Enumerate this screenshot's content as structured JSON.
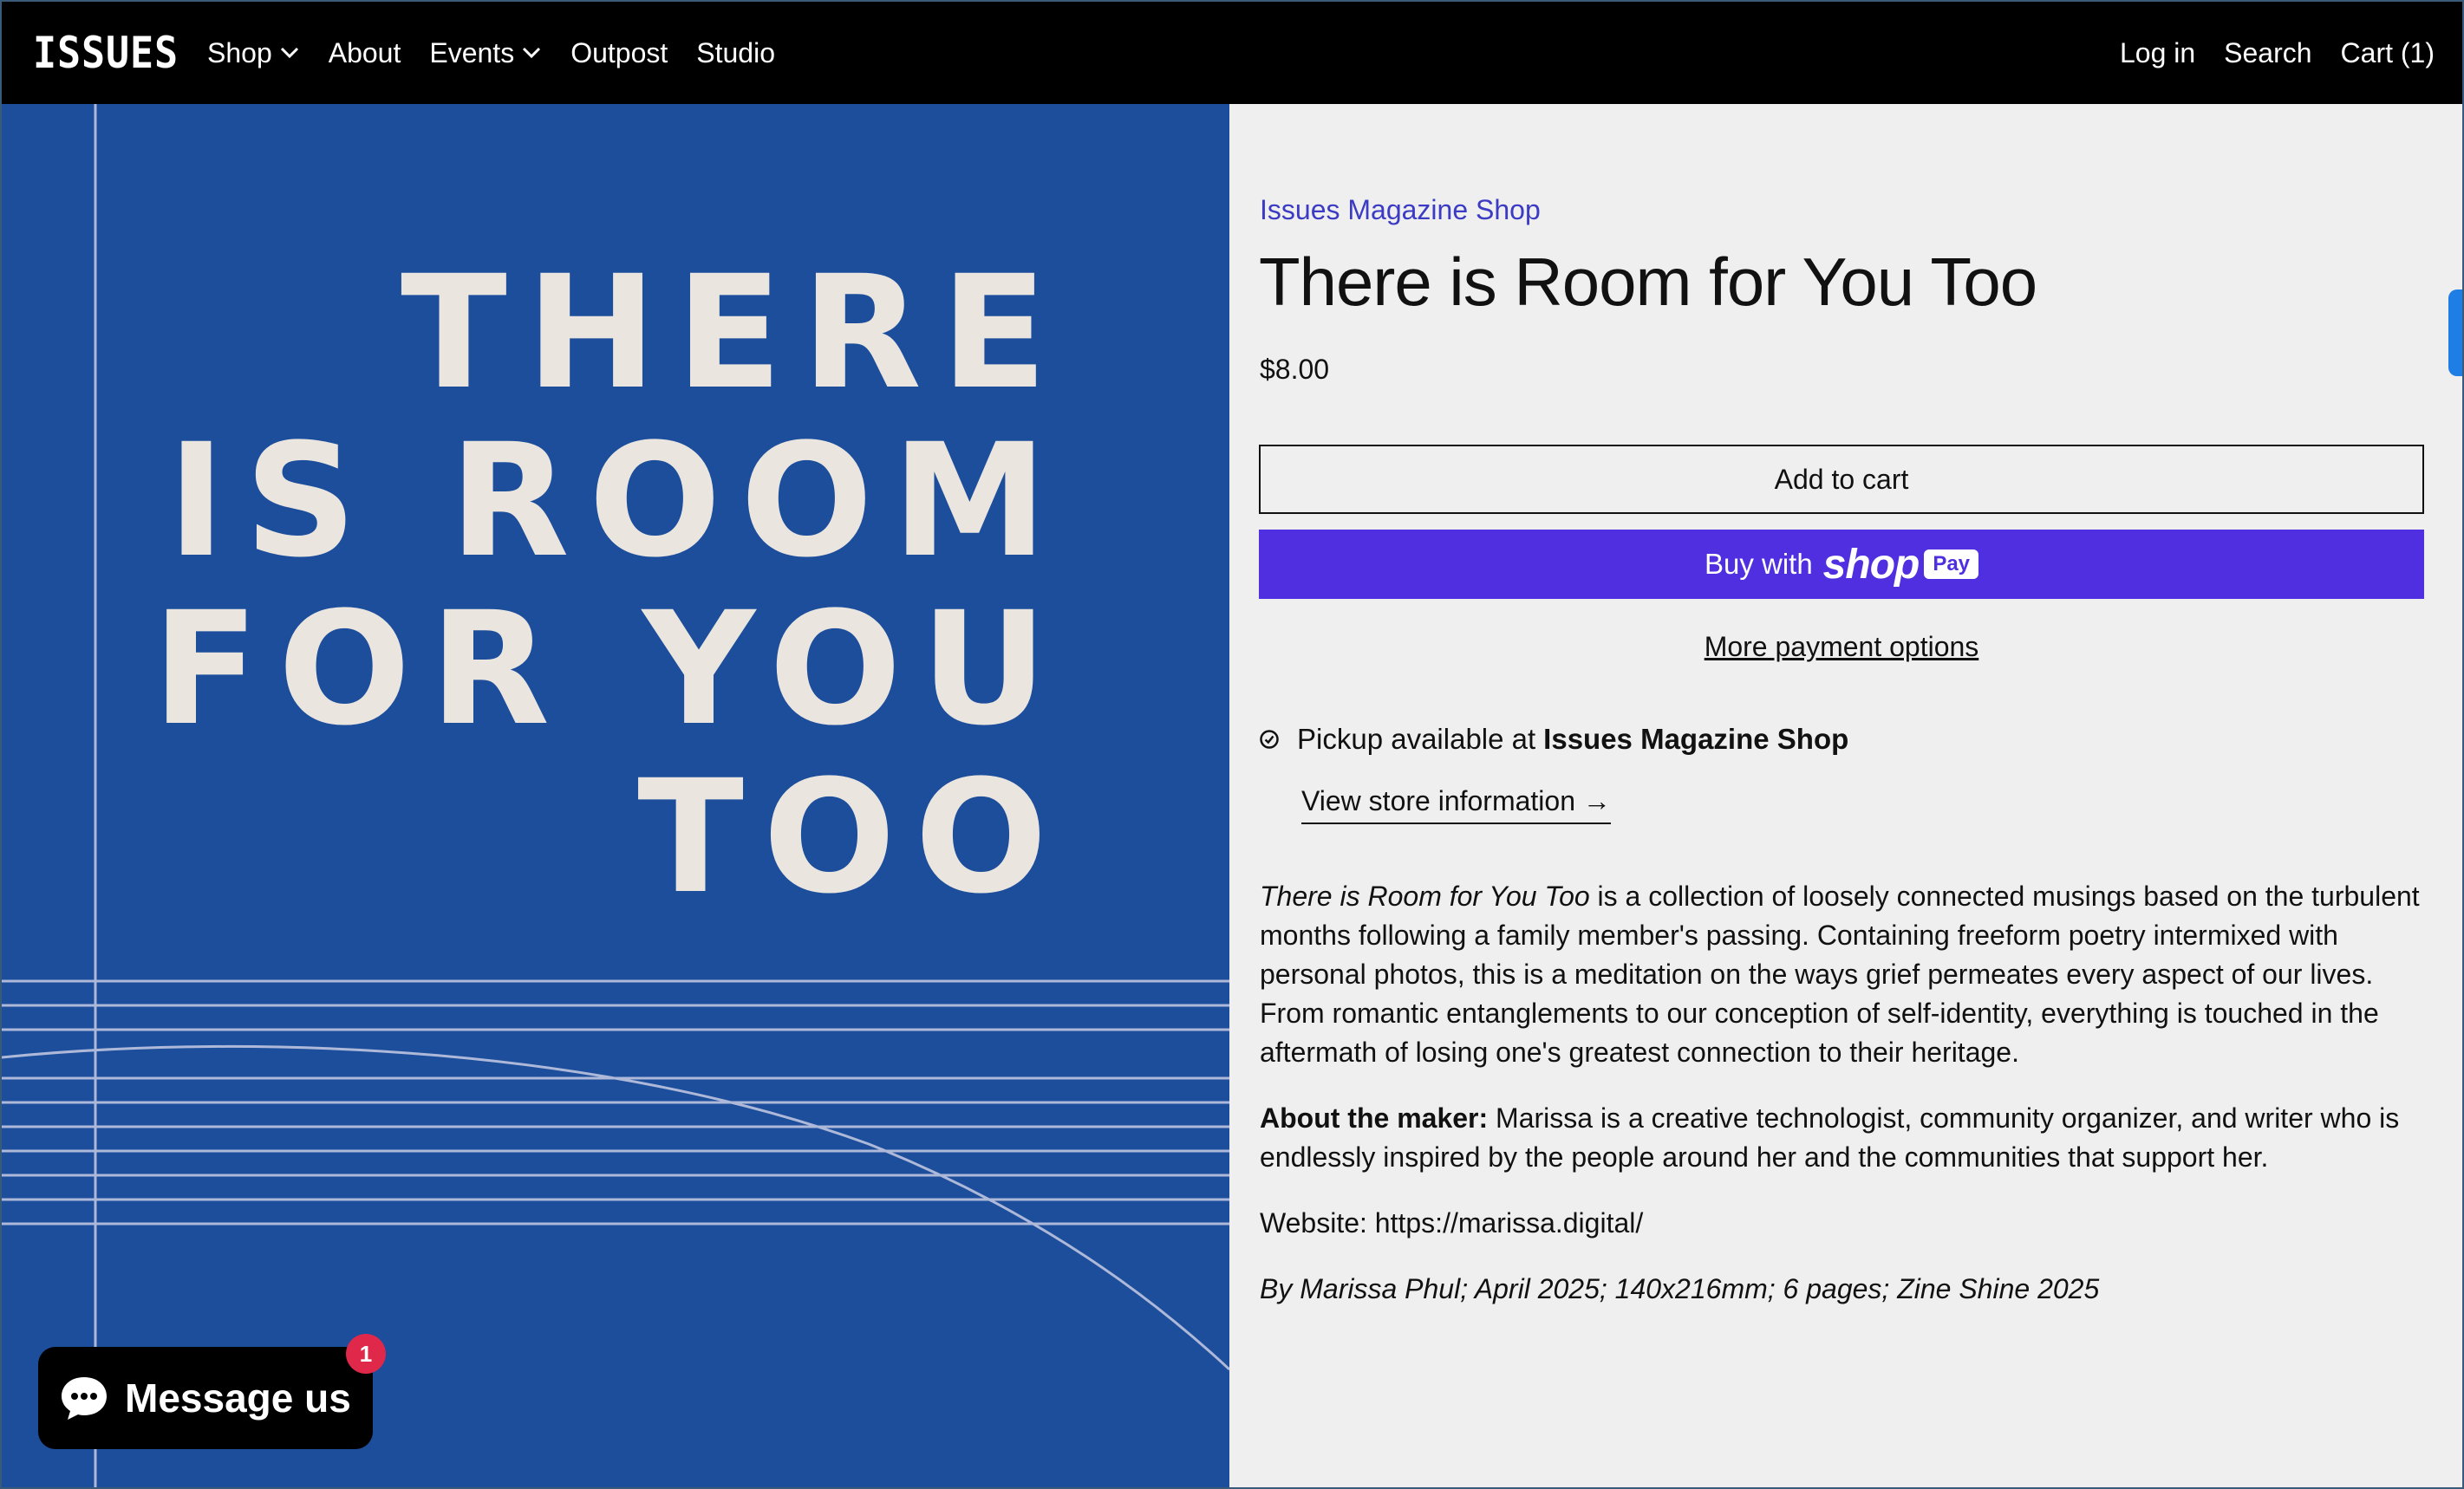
{
  "header": {
    "logo": "ISSUES",
    "nav": [
      {
        "label": "Shop",
        "has_dropdown": true
      },
      {
        "label": "About",
        "has_dropdown": false
      },
      {
        "label": "Events",
        "has_dropdown": true
      },
      {
        "label": "Outpost",
        "has_dropdown": false
      },
      {
        "label": "Studio",
        "has_dropdown": false
      }
    ],
    "login": "Log in",
    "search": "Search",
    "cart": "Cart (1)"
  },
  "hero": {
    "lines": [
      "THERE",
      "IS ROOM",
      "FOR YOU",
      "TOO"
    ],
    "background": "#1c4e9c",
    "text_color": "#ebe5df"
  },
  "product": {
    "vendor": "Issues Magazine Shop",
    "title": "There is Room for You Too",
    "price": "$8.00",
    "add_to_cart": "Add to cart",
    "buy_with": "Buy with",
    "shop_brand": "shop",
    "pay_pill": "Pay",
    "more_payment": "More payment options",
    "pickup_prefix": "Pickup available at",
    "pickup_location": "Issues Magazine Shop",
    "store_info": "View store information →",
    "description": {
      "title_italic": "There is Room for You Too",
      "body": " is a collection of loosely connected musings based on the turbulent months following a family member's passing. Containing freeform poetry intermixed with personal photos, this is a meditation on the ways grief permeates every aspect of our lives. From romantic entanglements to our conception of self-identity, everything is touched in the aftermath of losing one's greatest connection to their heritage.",
      "maker_label": "About the maker:",
      "maker_body": " Marissa is a creative technologist, community organizer, and writer who is endlessly inspired by the people around her and the communities that support her.",
      "website": "Website: https://marissa.digital/",
      "credits": "By Marissa Phul; April 2025; 140x216mm; 6 pages; Zine Shine 2025"
    }
  },
  "chat": {
    "label": "Message us",
    "badge": "1"
  },
  "colors": {
    "accent_purple": "#4f2fe0",
    "vendor_link": "#3b3bc4",
    "badge_red": "#e0284a"
  }
}
